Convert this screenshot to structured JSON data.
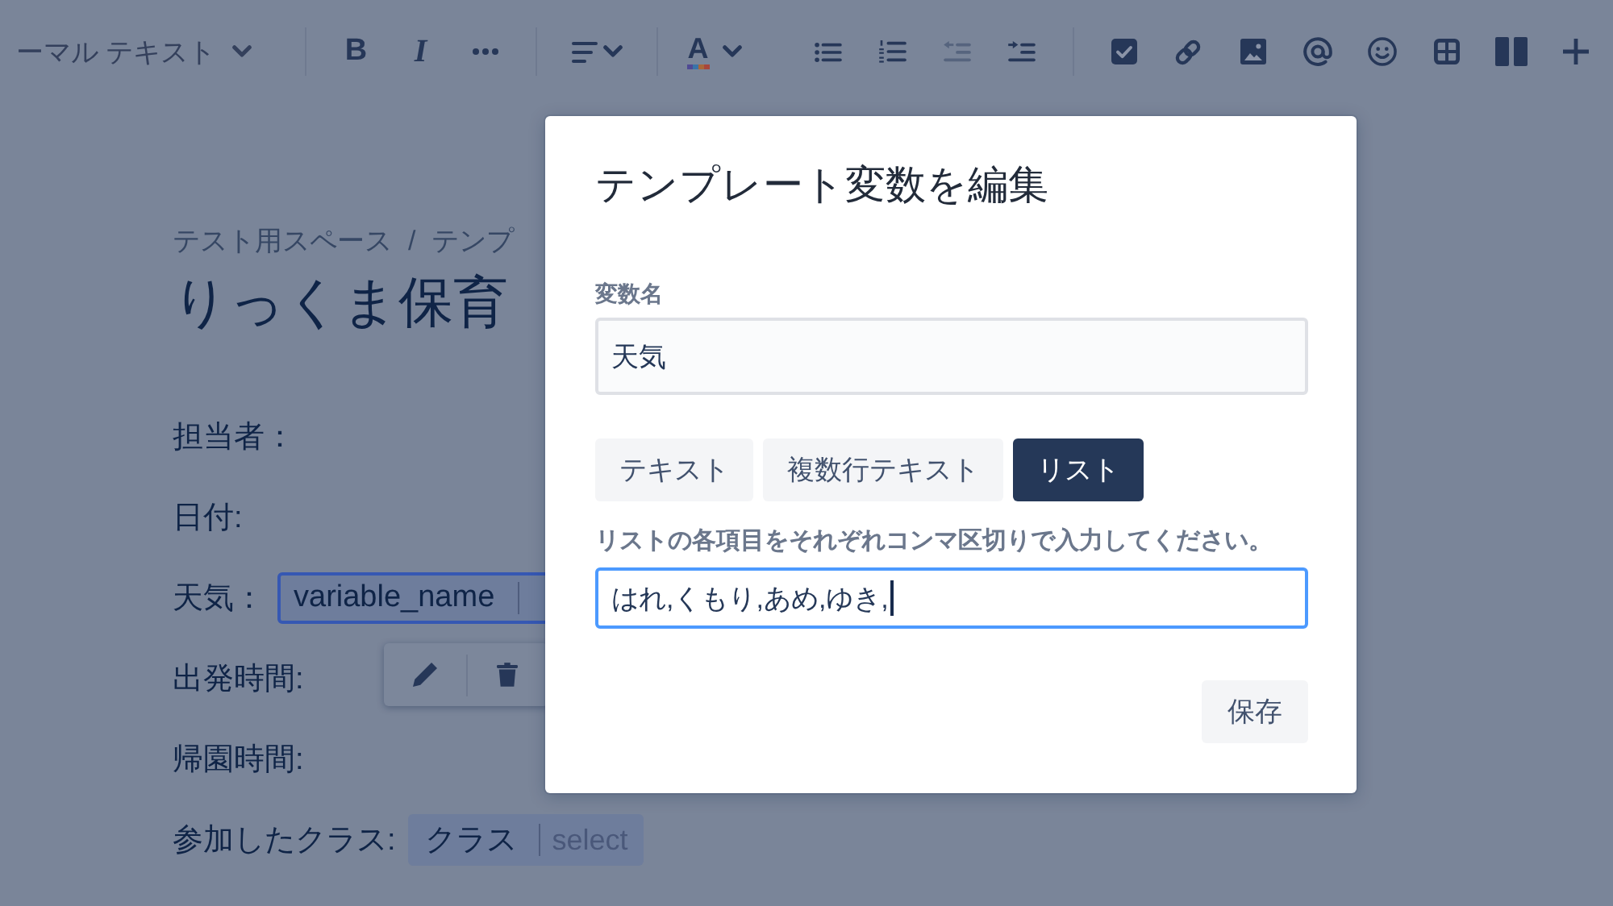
{
  "toolbar": {
    "text_style": "ーマル テキスト",
    "groups": [
      [
        {
          "kind": "bold",
          "label": "B",
          "disabled": false
        },
        {
          "kind": "italic",
          "label": "I",
          "disabled": false
        },
        {
          "kind": "more",
          "disabled": false
        }
      ],
      [
        {
          "kind": "align",
          "disabled": false
        }
      ],
      [
        {
          "kind": "text-color",
          "label": "A",
          "disabled": false
        },
        {
          "kind": "bullet-list",
          "disabled": false
        },
        {
          "kind": "numbered-list",
          "disabled": false
        },
        {
          "kind": "outdent",
          "disabled": true
        },
        {
          "kind": "indent",
          "disabled": false
        }
      ],
      [
        {
          "kind": "task",
          "disabled": false
        },
        {
          "kind": "link",
          "disabled": false
        },
        {
          "kind": "image",
          "disabled": false
        },
        {
          "kind": "mention",
          "disabled": false
        },
        {
          "kind": "emoji",
          "disabled": false
        },
        {
          "kind": "table",
          "disabled": false
        },
        {
          "kind": "layout",
          "disabled": false
        },
        {
          "kind": "insert",
          "disabled": false
        }
      ]
    ]
  },
  "page": {
    "breadcrumb": [
      {
        "kind": "link",
        "text": "テスト用スペース"
      },
      {
        "kind": "separator",
        "text": "/"
      },
      {
        "kind": "link",
        "text": "テンプ"
      }
    ],
    "title": "りっくま保育",
    "lines": [
      {
        "label": "担当者："
      },
      {
        "label": "日付:"
      },
      {
        "label": "天気：",
        "variable": {
          "name": "variable_name",
          "selected": true
        }
      },
      {
        "label": "出発時間:"
      },
      {
        "label": "帰園時間:"
      },
      {
        "label": "参加したクラス:",
        "variable": {
          "name": "クラス",
          "type": "select",
          "selected": false
        }
      }
    ]
  },
  "dialog": {
    "title": "テンプレート変数を編集",
    "name_field": {
      "label": "変数名",
      "value": "天気",
      "focused": false
    },
    "type_tabs": [
      {
        "label": "テキスト",
        "selected": false
      },
      {
        "label": "複数行テキスト",
        "selected": false
      },
      {
        "label": "リスト",
        "selected": true
      }
    ],
    "list_field": {
      "label": "リストの各項目をそれぞれコンマ区切りで入力してください。",
      "value": "はれ,くもり,あめ,ゆき,",
      "focused": true
    },
    "save_button": "保存"
  }
}
